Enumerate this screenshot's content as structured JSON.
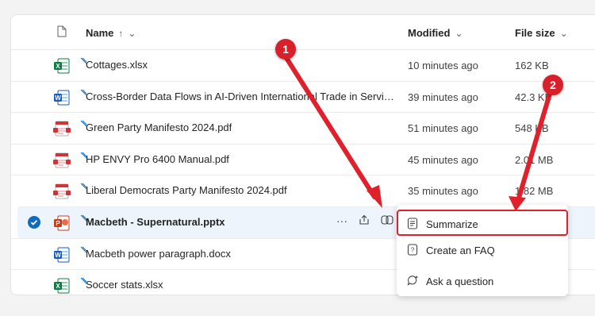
{
  "header": {
    "name_label": "Name",
    "sort_indicator": "↑",
    "name_chevron": "⌄",
    "modified_label": "Modified",
    "modified_chevron": "⌄",
    "filesize_label": "File size",
    "filesize_chevron": "⌄"
  },
  "files": [
    {
      "name": "Cottages.xlsx",
      "type": "excel",
      "modified": "10 minutes ago",
      "size": "162 KB"
    },
    {
      "name": "Cross-Border Data Flows in AI-Driven International Trade in Services....",
      "type": "word",
      "modified": "39 minutes ago",
      "size": "42.3 KB"
    },
    {
      "name": "Green Party Manifesto 2024.pdf",
      "type": "pdf",
      "modified": "51 minutes ago",
      "size": "548 KB"
    },
    {
      "name": "HP ENVY Pro 6400 Manual.pdf",
      "type": "pdf",
      "modified": "45 minutes ago",
      "size": "2.01 MB"
    },
    {
      "name": "Liberal Democrats Party Manifesto 2024.pdf",
      "type": "pdf",
      "modified": "35 minutes ago",
      "size": "1.82 MB"
    },
    {
      "name": "Macbeth - Supernatural.pptx",
      "type": "powerpoint",
      "modified": "",
      "size": "",
      "selected": true
    },
    {
      "name": "Macbeth power paragraph.docx",
      "type": "word",
      "modified": "",
      "size": ""
    },
    {
      "name": "Soccer stats.xlsx",
      "type": "excel",
      "modified": "",
      "size": ""
    }
  ],
  "row_actions": {
    "more": "···"
  },
  "menu": {
    "items": [
      {
        "label": "Summarize",
        "icon": "summarize-icon"
      },
      {
        "label": "Create an FAQ",
        "icon": "faq-icon"
      },
      {
        "label": "Ask a question",
        "icon": "ask-question-icon"
      }
    ]
  },
  "annotations": [
    {
      "number": "1"
    },
    {
      "number": "2"
    }
  ],
  "colors": {
    "accent": "#0f6cbd",
    "annotation_red": "#d8202a",
    "excel": "#107c41",
    "word": "#185abd",
    "powerpoint": "#c43e1c",
    "pdf": "#d13438"
  }
}
